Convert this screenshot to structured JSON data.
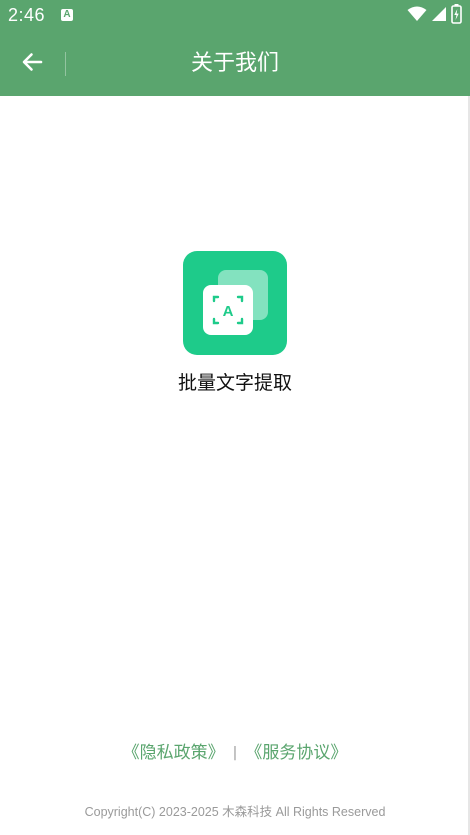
{
  "status_bar": {
    "time": "2:46",
    "notification_icon_letter": "A",
    "icons": [
      "wifi-icon",
      "signal-icon",
      "battery-icon"
    ]
  },
  "toolbar": {
    "back_icon": "arrow-left-icon",
    "title": "关于我们"
  },
  "app": {
    "icon": "text-recognition-app-icon",
    "icon_letter": "A",
    "name": "批量文字提取"
  },
  "links": {
    "privacy_policy": "《隐私政策》",
    "separator": "|",
    "service_agreement": "《服务协议》"
  },
  "footer": {
    "copyright": "Copyright(C) 2023-2025 木森科技 All Rights Reserved"
  },
  "colors": {
    "header_bg": "#5aa56e",
    "accent_green": "#5aa56e",
    "app_icon_bg": "#1ecb8a",
    "footer_text": "#9a9a9a"
  }
}
